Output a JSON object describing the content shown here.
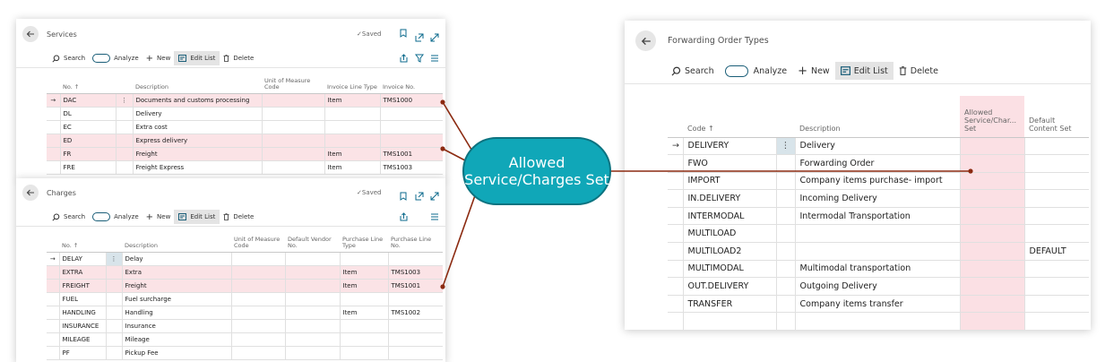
{
  "services": {
    "title": "Services",
    "saved": "Saved",
    "actions": {
      "search": "Search",
      "analyze": "Analyze",
      "new": "New",
      "edit_list": "Edit List",
      "delete": "Delete"
    },
    "columns": [
      "No. ↑",
      "Description",
      "Unit of Measure Code",
      "Invoice Line Type",
      "Invoice No."
    ],
    "rows": [
      {
        "no": "DAC",
        "description": "Documents and customs processing",
        "uom": "",
        "line_type": "Item",
        "invoice_no": "TMS1000",
        "highlight": true,
        "selected": true
      },
      {
        "no": "DL",
        "description": "Delivery",
        "uom": "",
        "line_type": "",
        "invoice_no": "",
        "highlight": false
      },
      {
        "no": "EC",
        "description": "Extra cost",
        "uom": "",
        "line_type": "",
        "invoice_no": "",
        "highlight": false
      },
      {
        "no": "ED",
        "description": "Express delivery",
        "uom": "",
        "line_type": "",
        "invoice_no": "",
        "highlight": true
      },
      {
        "no": "FR",
        "description": "Freight",
        "uom": "",
        "line_type": "Item",
        "invoice_no": "TMS1001",
        "highlight": true
      },
      {
        "no": "FRE",
        "description": "Freight Express",
        "uom": "",
        "line_type": "Item",
        "invoice_no": "TMS1003",
        "highlight": false
      }
    ]
  },
  "charges": {
    "title": "Charges",
    "saved": "Saved",
    "actions": {
      "search": "Search",
      "analyze": "Analyze",
      "new": "New",
      "edit_list": "Edit List",
      "delete": "Delete"
    },
    "columns": [
      "No. ↑",
      "Description",
      "Unit of Measure Code",
      "Default Vendor No.",
      "Purchase Line Type",
      "Purchase Line No."
    ],
    "rows": [
      {
        "no": "DELAY",
        "description": "Delay",
        "uom": "",
        "vendor": "",
        "line_type": "",
        "line_no": "",
        "highlight": false,
        "selected": true
      },
      {
        "no": "EXTRA",
        "description": "Extra",
        "uom": "",
        "vendor": "",
        "line_type": "Item",
        "line_no": "TMS1003",
        "highlight": true
      },
      {
        "no": "FREIGHT",
        "description": "Freight",
        "uom": "",
        "vendor": "",
        "line_type": "Item",
        "line_no": "TMS1001",
        "highlight": true
      },
      {
        "no": "FUEL",
        "description": "Fuel surcharge",
        "uom": "",
        "vendor": "",
        "line_type": "",
        "line_no": "",
        "highlight": false
      },
      {
        "no": "HANDLING",
        "description": "Handling",
        "uom": "",
        "vendor": "",
        "line_type": "Item",
        "line_no": "TMS1002",
        "highlight": false
      },
      {
        "no": "INSURANCE",
        "description": "Insurance",
        "uom": "",
        "vendor": "",
        "line_type": "",
        "line_no": "",
        "highlight": false
      },
      {
        "no": "MILEAGE",
        "description": "Mileage",
        "uom": "",
        "vendor": "",
        "line_type": "",
        "line_no": "",
        "highlight": false
      },
      {
        "no": "PF",
        "description": "Pickup Fee",
        "uom": "",
        "vendor": "",
        "line_type": "",
        "line_no": "",
        "highlight": false
      }
    ]
  },
  "forwarding_order_types": {
    "title": "Forwarding Order Types",
    "actions": {
      "search": "Search",
      "analyze": "Analyze",
      "new": "New",
      "edit_list": "Edit List",
      "delete": "Delete"
    },
    "columns": [
      "Code ↑",
      "Description",
      "Allowed Service/Char... Set",
      "Default Content Set"
    ],
    "rows": [
      {
        "code": "DELIVERY",
        "description": "Delivery",
        "allowed_set": "",
        "content_set": "",
        "selected": true
      },
      {
        "code": "FWO",
        "description": "Forwarding Order",
        "allowed_set": "",
        "content_set": ""
      },
      {
        "code": "IMPORT",
        "description": "Company items purchase- import",
        "allowed_set": "",
        "content_set": ""
      },
      {
        "code": "IN.DELIVERY",
        "description": "Incoming Delivery",
        "allowed_set": "",
        "content_set": ""
      },
      {
        "code": "INTERMODAL",
        "description": "Intermodal Transportation",
        "allowed_set": "",
        "content_set": ""
      },
      {
        "code": "MULTILOAD",
        "description": "",
        "allowed_set": "",
        "content_set": ""
      },
      {
        "code": "MULTILOAD2",
        "description": "",
        "allowed_set": "",
        "content_set": "DEFAULT"
      },
      {
        "code": "MULTIMODAL",
        "description": "Multimodal transportation",
        "allowed_set": "",
        "content_set": ""
      },
      {
        "code": "OUT.DELIVERY",
        "description": "Outgoing Delivery",
        "allowed_set": "",
        "content_set": ""
      },
      {
        "code": "TRANSFER",
        "description": "Company items transfer",
        "allowed_set": "",
        "content_set": ""
      },
      {
        "code": "",
        "description": "",
        "allowed_set": "",
        "content_set": ""
      }
    ]
  },
  "callout": {
    "text": "Allowed Service/Charges Set"
  },
  "colors": {
    "highlight_row": "#fbe3e6",
    "bubble": "#10a7b8",
    "connector": "#8b2a10",
    "accent": "#0b6a8c"
  },
  "icons": [
    "back-arrow-icon",
    "checkmark-icon",
    "bookmark-icon",
    "open-new-window-icon",
    "expand-icon",
    "search-icon",
    "toggle-icon",
    "plus-icon",
    "edit-list-icon",
    "trash-icon",
    "share-icon",
    "filter-icon",
    "list-view-icon",
    "row-arrow-icon",
    "row-menu-dots-icon"
  ]
}
